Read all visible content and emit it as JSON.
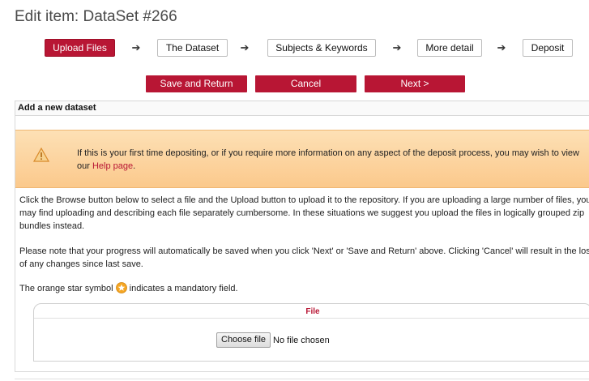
{
  "page": {
    "title": "Edit item: DataSet #266"
  },
  "steps": [
    {
      "label": "Upload Files",
      "active": true
    },
    {
      "label": "The Dataset",
      "active": false
    },
    {
      "label": "Subjects & Keywords",
      "active": false
    },
    {
      "label": "More detail",
      "active": false
    },
    {
      "label": "Deposit",
      "active": false
    }
  ],
  "step_arrow": "➔",
  "actions": {
    "save_return": "Save and Return",
    "cancel": "Cancel",
    "next": "Next >"
  },
  "panel": {
    "header": "Add a new dataset",
    "warning_text": "If this is your first time depositing, or if you require more information on any aspect of the deposit process, you may wish to view our ",
    "help_link": "Help page",
    "warning_end": ".",
    "para1": "Click the Browse button below to select a file and the Upload button to upload it to the repository. If you are uploading a large number of files, you may find uploading and describing each file separately cumbersome. In these situations we suggest you upload the files in logically grouped zip bundles instead.",
    "para2": "Please note that your progress will automatically be saved when you click 'Next' or 'Save and Return' above. Clicking 'Cancel' will result in the loss of any changes since last save.",
    "para3_before": "The orange star symbol ",
    "para3_after": " indicates a mandatory field."
  },
  "file_field": {
    "label": "File",
    "button": "Choose file",
    "status": "No file chosen"
  },
  "colors": {
    "brand_red": "#b81634",
    "warning_bg": "#fbc98c",
    "star_orange": "#f5a623"
  }
}
